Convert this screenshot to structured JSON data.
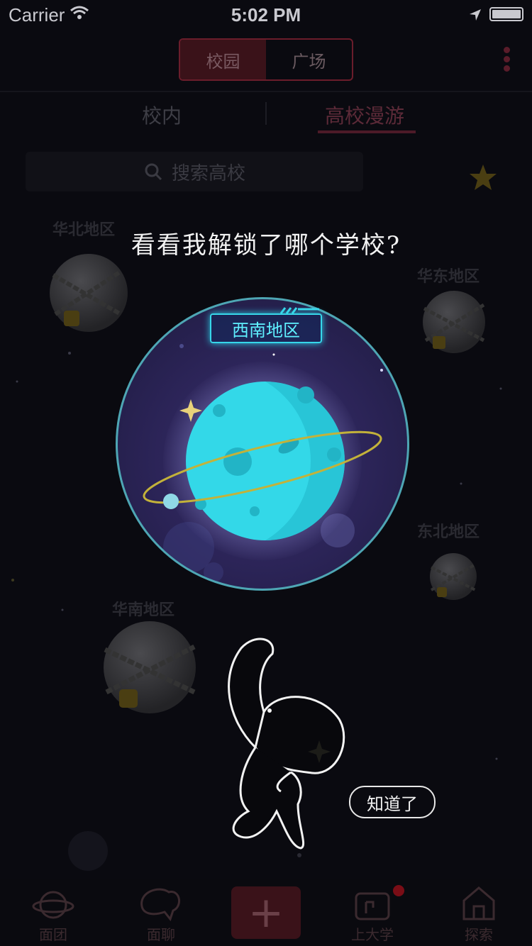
{
  "status_bar": {
    "carrier": "Carrier",
    "time": "5:02 PM"
  },
  "header": {
    "segments": [
      {
        "label": "校园",
        "active": true
      },
      {
        "label": "广场",
        "active": false
      }
    ],
    "menu_icon": "more-vertical-icon"
  },
  "sub_tabs": [
    {
      "label": "校内"
    },
    {
      "label": "高校漫游",
      "active": true
    }
  ],
  "search": {
    "placeholder": "搜索高校"
  },
  "regions": {
    "north": "华北地区",
    "east": "华东地区",
    "northeast": "东北地区",
    "south": "华南地区"
  },
  "overlay": {
    "prompt": "看看我解锁了哪个学校?",
    "unlocked_region": "西南地区",
    "ack_button": "知道了"
  },
  "bottom_nav": [
    {
      "label": "面团",
      "icon": "planet-icon"
    },
    {
      "label": "面聊",
      "icon": "elephant-chat-icon"
    },
    {
      "label": "",
      "icon": "plus-icon"
    },
    {
      "label": "上大学",
      "icon": "school-icon",
      "badge": true
    },
    {
      "label": "探索",
      "icon": "house-icon"
    }
  ],
  "colors": {
    "accent": "#6b1d2b",
    "badge_cyan": "#37d7ea",
    "planet": "#35d8e6",
    "background": "#0a0a10"
  }
}
